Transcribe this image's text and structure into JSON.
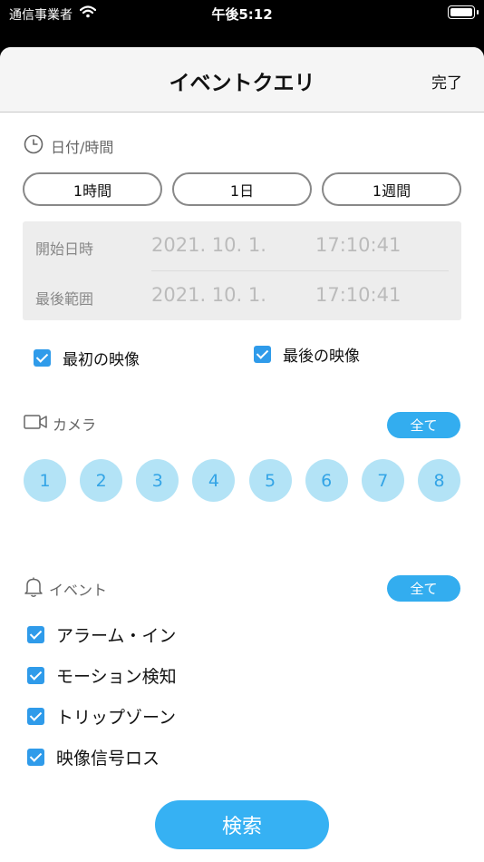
{
  "status_bar": {
    "carrier": "通信事業者",
    "time": "午後5:12"
  },
  "nav": {
    "title": "イベントクエリ",
    "done_label": "完了"
  },
  "datetime": {
    "section_label": "日付/時間",
    "range_buttons": [
      "1時間",
      "1日",
      "1週間"
    ],
    "start_label": "開始日時",
    "start_date": "2021. 10. 1.",
    "start_time": "17:10:41",
    "end_label": "最後範囲",
    "end_date": "2021. 10. 1.",
    "end_time": "17:10:41"
  },
  "image_options": [
    {
      "label": "最初の映像",
      "checked": true
    },
    {
      "label": "最後の映像",
      "checked": true
    }
  ],
  "camera": {
    "section_label": "カメラ",
    "all_label": "全て",
    "channels": [
      "1",
      "2",
      "3",
      "4",
      "5",
      "6",
      "7",
      "8"
    ]
  },
  "event": {
    "section_label": "イベント",
    "all_label": "全て",
    "types": [
      {
        "label": "アラーム・イン",
        "checked": true
      },
      {
        "label": "モーション検知",
        "checked": true
      },
      {
        "label": "トリップゾーン",
        "checked": true
      },
      {
        "label": "映像信号ロス",
        "checked": true
      }
    ]
  },
  "search_label": "検索",
  "colors": {
    "accent": "#33adef",
    "camera_chip_bg": "#b3e3f6",
    "checkbox": "#2f9bea"
  }
}
